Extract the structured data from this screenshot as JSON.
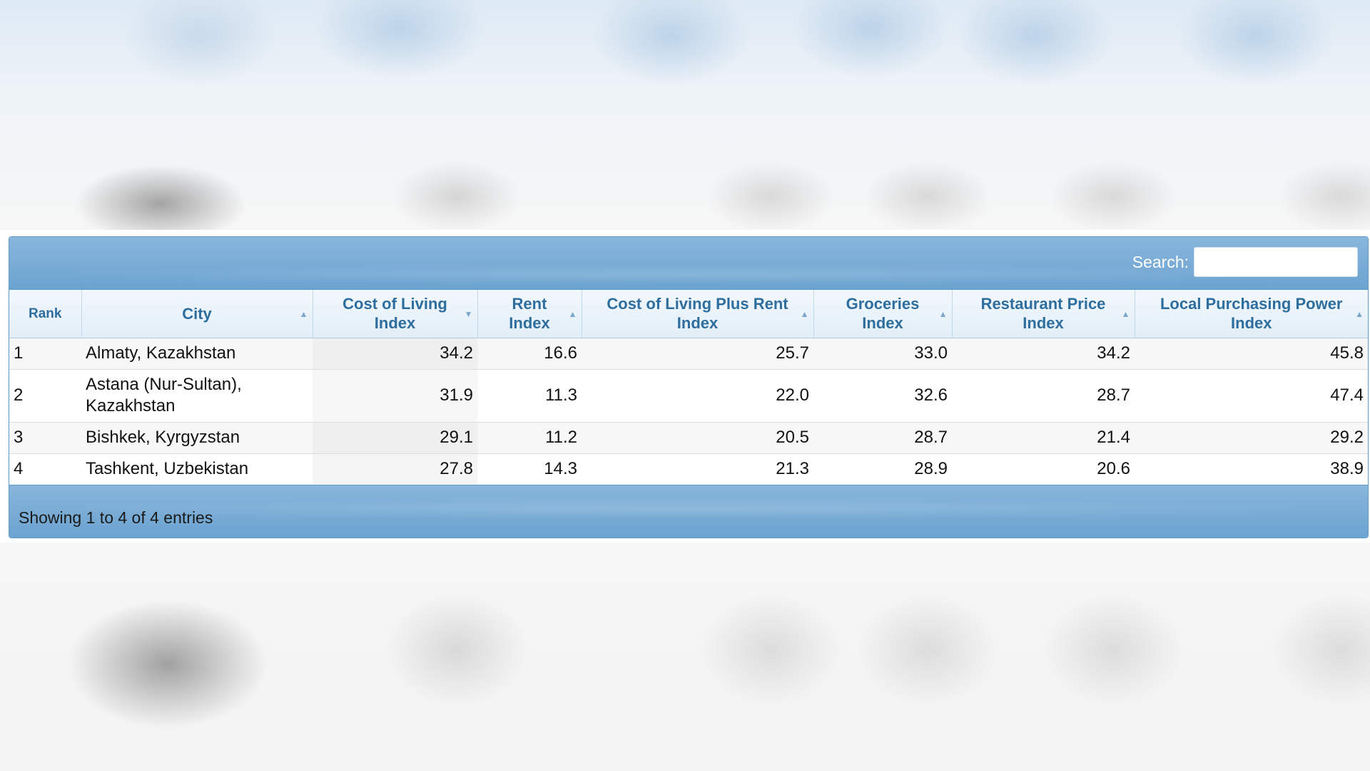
{
  "search": {
    "label": "Search:",
    "value": ""
  },
  "table": {
    "columns": [
      "Rank",
      "City",
      "Cost of Living Index",
      "Rent Index",
      "Cost of Living Plus Rent Index",
      "Groceries Index",
      "Restaurant Price Index",
      "Local Purchasing Power Index"
    ],
    "rows": [
      {
        "rank": "1",
        "city": "Almaty, Kazakhstan",
        "col": "34.2",
        "rent": "16.6",
        "colr": "25.7",
        "groceries": "33.0",
        "restaurant": "34.2",
        "lpp": "45.8"
      },
      {
        "rank": "2",
        "city": "Astana (Nur-Sultan), Kazakhstan",
        "col": "31.9",
        "rent": "11.3",
        "colr": "22.0",
        "groceries": "32.6",
        "restaurant": "28.7",
        "lpp": "47.4"
      },
      {
        "rank": "3",
        "city": "Bishkek, Kyrgyzstan",
        "col": "29.1",
        "rent": "11.2",
        "colr": "20.5",
        "groceries": "28.7",
        "restaurant": "21.4",
        "lpp": "29.2"
      },
      {
        "rank": "4",
        "city": "Tashkent, Uzbekistan",
        "col": "27.8",
        "rent": "14.3",
        "colr": "21.3",
        "groceries": "28.9",
        "restaurant": "20.6",
        "lpp": "38.9"
      }
    ],
    "sorted_column": "Cost of Living Index",
    "sort_direction": "descending"
  },
  "footer": {
    "info": "Showing 1 to 4 of 4 entries"
  },
  "icons": {
    "sortable": "sort-asc-icon",
    "sorted": "sort-desc-icon"
  },
  "colors": {
    "header_text": "#2e6e9e",
    "toolbar": "#7aaed6",
    "border": "#5f9bc9"
  }
}
